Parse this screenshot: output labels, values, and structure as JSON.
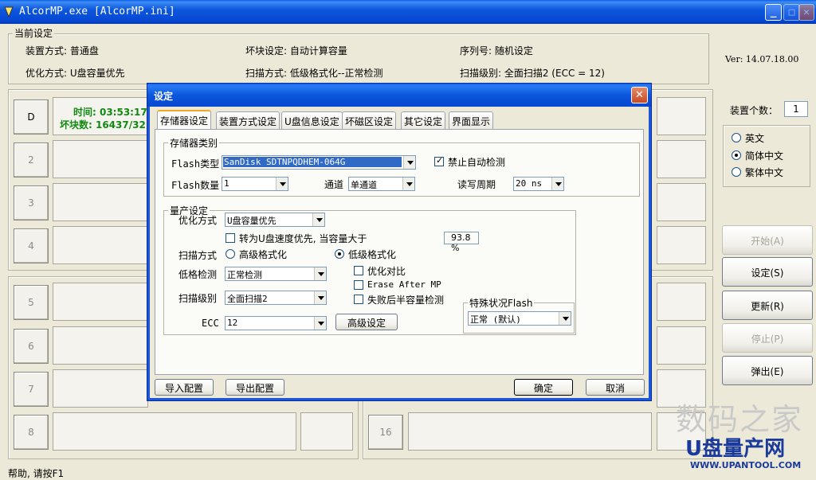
{
  "window": {
    "title": "AlcorMP.exe [AlcorMP.ini]"
  },
  "current": {
    "group_label": "当前设定",
    "device_mode": "装置方式: 普通盘",
    "bad_block": "坏块设定: 自动计算容量",
    "serial": "序列号: 随机设定",
    "optimize": "优化方式: U盘容量优先",
    "scan_mode": "扫描方式: 低级格式化--正常检测",
    "scan_level": "扫描级别: 全面扫描2 (ECC = 12)"
  },
  "version": "Ver: 14.07.18.00",
  "device_count": {
    "label": "装置个数：",
    "value": "1"
  },
  "language": {
    "options": [
      "英文",
      "简体中文",
      "繁体中文"
    ],
    "selected": 1
  },
  "side_buttons": {
    "start": "开始(A)",
    "settings": "设定(S)",
    "refresh": "更新(R)",
    "stop": "停止(P)",
    "eject": "弹出(E)"
  },
  "slots": {
    "d_label": "D",
    "time_label": "时间: 03:53:17",
    "bad_label": "坏块数: 16437/32",
    "left": [
      "2",
      "3",
      "4",
      "5",
      "6",
      "7",
      "8"
    ],
    "right": [
      "16"
    ]
  },
  "status": {
    "help": "帮助, 请按F1"
  },
  "dialog": {
    "title": "设定",
    "tabs": [
      "存储器设定",
      "装置方式设定",
      "U盘信息设定",
      "坏磁区设定",
      "其它设定",
      "界面显示"
    ],
    "storage": {
      "group_label": "存储器类别",
      "flash_type_label": "Flash类型",
      "flash_type_value": "SanDisk SDTNPQDHEM-064G",
      "disable_auto_label": "禁止自动检测",
      "flash_count_label": "Flash数量",
      "flash_count_value": "1",
      "channel_label": "通道",
      "channel_value": "单通道",
      "cycle_label": "读写周期",
      "cycle_value": "20 ns"
    },
    "production": {
      "group_label": "量产设定",
      "optimize_label": "优化方式",
      "optimize_value": "U盘容量优先",
      "speed_label": "转为U盘速度优先, 当容量大于",
      "speed_value": "93.8",
      "speed_unit": "%",
      "scan_mode_label": "扫描方式",
      "scan_high": "高级格式化",
      "scan_low": "低级格式化",
      "low_check_label": "低格检测",
      "low_check_value": "正常检测",
      "opt_compare": "优化对比",
      "erase_after": "Erase After MP",
      "half_check": "失败后半容量检测",
      "scan_level_label": "扫描级别",
      "scan_level_value": "全面扫描2",
      "ecc_label": "ECC",
      "ecc_value": "12",
      "advanced_button": "高级设定",
      "special_label": "特殊状况Flash",
      "special_value": "正常 (默认)"
    },
    "import_button": "导入配置",
    "export_button": "导出配置",
    "ok_button": "确定",
    "cancel_button": "取消"
  },
  "watermark": {
    "line1": "数码之家",
    "line2": "U盘量产网",
    "line3": "WWW.UPANTOOL.COM"
  }
}
